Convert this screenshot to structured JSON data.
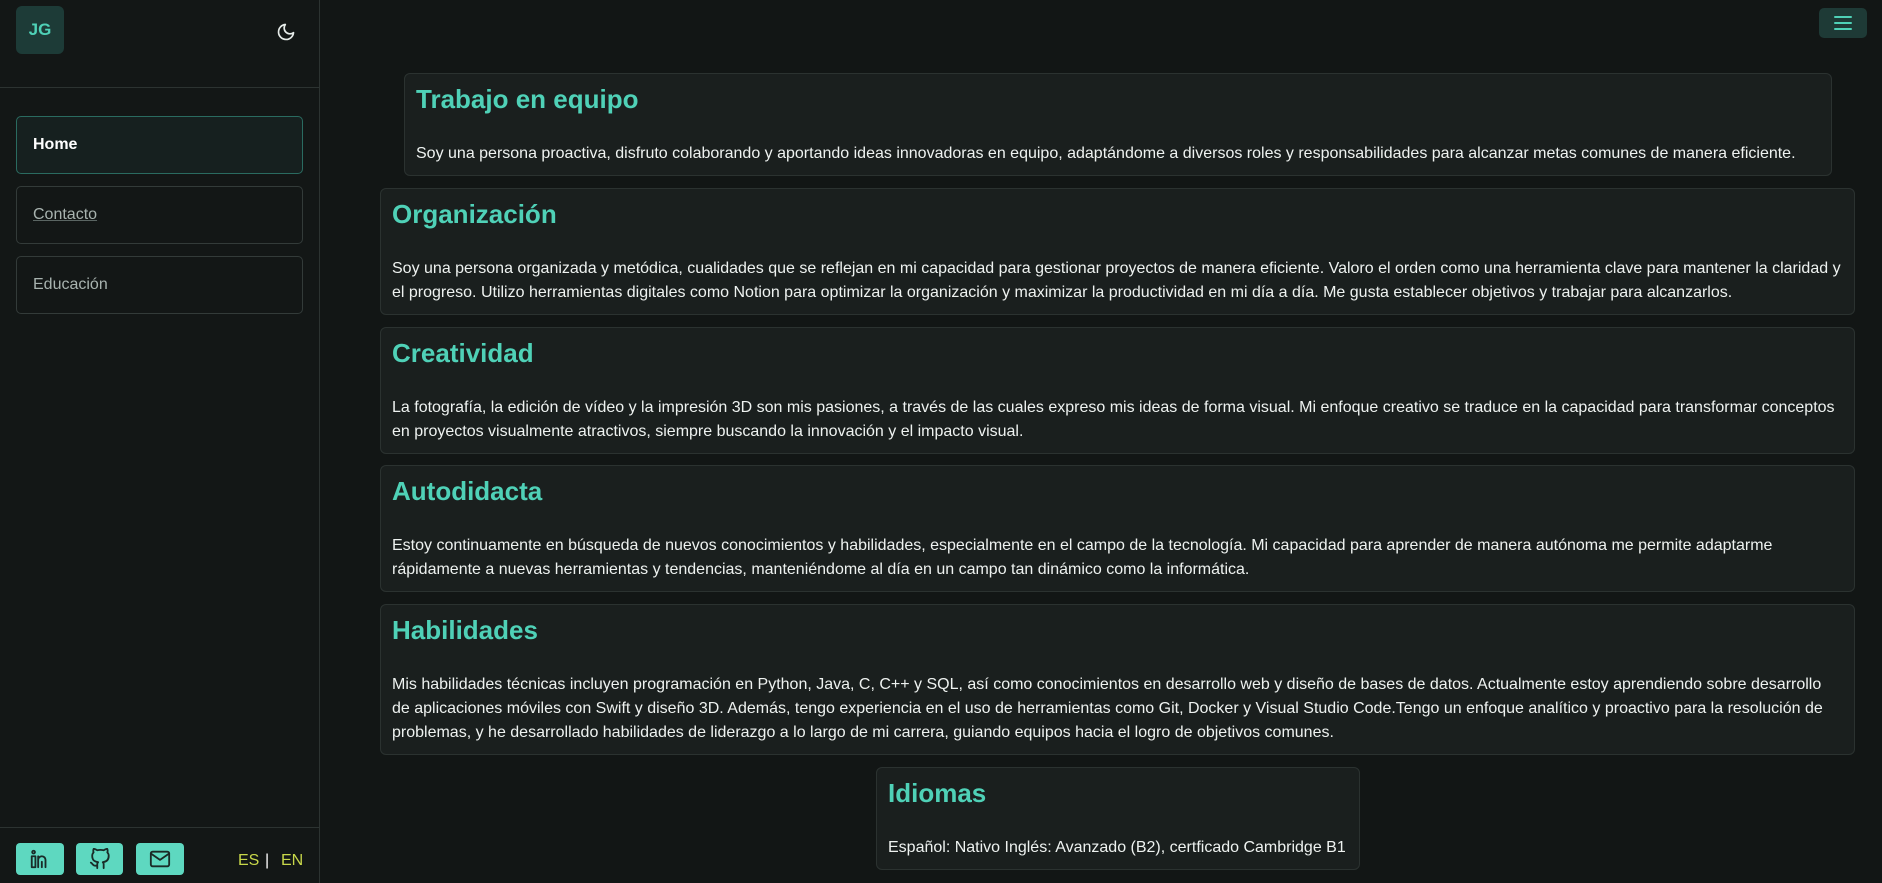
{
  "sidebar": {
    "avatar_initials": "JG",
    "theme_icon": "moon-icon",
    "nav": [
      {
        "label": "Home",
        "active": true
      },
      {
        "label": "Contacto",
        "active": false
      },
      {
        "label": "Educación",
        "active": false
      }
    ],
    "social": [
      {
        "icon": "linkedin-icon"
      },
      {
        "icon": "github-icon"
      },
      {
        "icon": "mail-icon"
      }
    ],
    "lang": {
      "es": "ES",
      "separator": "|",
      "en": "EN"
    }
  },
  "header": {
    "menu_icon": "hamburger-menu-icon"
  },
  "sections": [
    {
      "title": "Trabajo en equipo",
      "text": "Soy una persona proactiva, disfruto colaborando y aportando ideas innovadoras en equipo, adaptándome a diversos roles y responsabilidades para alcanzar metas comunes de manera eficiente."
    },
    {
      "title": "Organización",
      "text": "Soy una persona organizada y metódica, cualidades que se reflejan en mi capacidad para gestionar proyectos de manera eficiente. Valoro el orden como una herramienta clave para mantener la claridad y el progreso. Utilizo herramientas digitales como Notion para optimizar la organización y maximizar la productividad en mi día a día. Me gusta establecer objetivos y trabajar para alcanzarlos."
    },
    {
      "title": "Creatividad",
      "text": "La fotografía, la edición de vídeo y la impresión 3D son mis pasiones, a través de las cuales expreso mis ideas de forma visual. Mi enfoque creativo se traduce en la capacidad para transformar conceptos en proyectos visualmente atractivos, siempre buscando la innovación y el impacto visual."
    },
    {
      "title": "Autodidacta",
      "text": "Estoy continuamente en búsqueda de nuevos conocimientos y habilidades, especialmente en el campo de la tecnología. Mi capacidad para aprender de manera autónoma me permite adaptarme rápidamente a nuevas herramientas y tendencias, manteniéndome al día en un campo tan dinámico como la informática."
    },
    {
      "title": "Habilidades",
      "text": "Mis habilidades técnicas incluyen programación en Python, Java, C, C++ y SQL, así como conocimientos en desarrollo web y diseño de bases de datos. Actualmente estoy aprendiendo sobre desarrollo de aplicaciones móviles con Swift y diseño 3D. Además, tengo experiencia en el uso de herramientas como Git, Docker y Visual Studio Code.Tengo un enfoque analítico y proactivo para la resolución de problemas, y he desarrollado habilidades de liderazgo a lo largo de mi carrera, guiando equipos hacia el logro de objetivos comunes."
    },
    {
      "title": "Idiomas",
      "text": "Español: Nativo Inglés: Avanzado (B2), certficado Cambridge B1"
    }
  ],
  "colors": {
    "accent": "#4fd1b7",
    "social_bg": "#5ed8c0",
    "lang": "#c8d84a",
    "background": "#121615",
    "card": "#1a1f1e"
  }
}
